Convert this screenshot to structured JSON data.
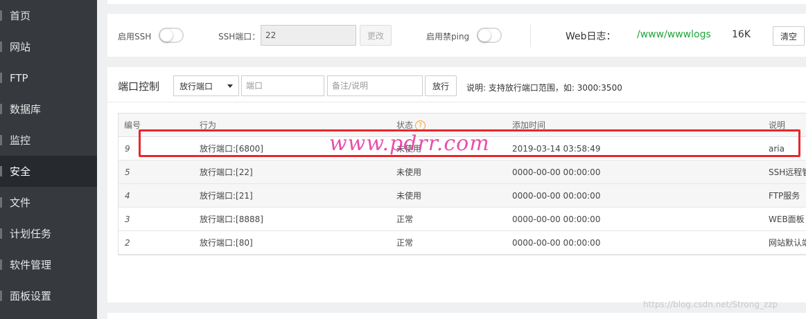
{
  "sidebar": {
    "items": [
      {
        "label": "首页"
      },
      {
        "label": "网站"
      },
      {
        "label": "FTP"
      },
      {
        "label": "数据库"
      },
      {
        "label": "监控"
      },
      {
        "label": "安全"
      },
      {
        "label": "文件"
      },
      {
        "label": "计划任务"
      },
      {
        "label": "软件管理"
      },
      {
        "label": "面板设置"
      }
    ],
    "active": "安全"
  },
  "settings": {
    "ssh_toggle_label": "启用SSH",
    "ssh_port_label": "SSH端口：",
    "ssh_port_value": "22",
    "change_button": "更改",
    "ping_toggle_label": "启用禁ping",
    "web_log_label": "Web日志：",
    "web_log_path": "/www/wwwlogs",
    "web_log_size": "16K",
    "clear_button": "清空"
  },
  "port_control": {
    "title": "端口控制",
    "action_select": "放行端口",
    "port_placeholder": "端口",
    "note_placeholder": "备注/说明",
    "submit_button": "放行",
    "hint": "说明: 支持放行端口范围，如: 3000:3500"
  },
  "table": {
    "headers": [
      "编号",
      "行为",
      "状态",
      "添加时间",
      "说明"
    ],
    "rows": [
      {
        "id": "9",
        "action": "放行端口:[6800]",
        "status": "未使用",
        "time": "2019-03-14 03:58:49",
        "note": "aria"
      },
      {
        "id": "5",
        "action": "放行端口:[22]",
        "status": "未使用",
        "time": "0000-00-00 00:00:00",
        "note": "SSH远程管"
      },
      {
        "id": "4",
        "action": "放行端口:[21]",
        "status": "未使用",
        "time": "0000-00-00 00:00:00",
        "note": "FTP服务"
      },
      {
        "id": "3",
        "action": "放行端口:[8888]",
        "status": "正常",
        "time": "0000-00-00 00:00:00",
        "note": "WEB面板"
      },
      {
        "id": "2",
        "action": "放行端口:[80]",
        "status": "正常",
        "time": "0000-00-00 00:00:00",
        "note": "网站默认端"
      }
    ]
  },
  "watermarks": {
    "site": "www.pdrr.com",
    "blog": "https://blog.csdn.net/Strong_zzp"
  },
  "colors": {
    "sidebar_bg": "#36393e",
    "sidebar_active": "#26292d",
    "log_path": "#20a53a",
    "annotation_red": "#e8262c",
    "watermark_pink": "#e83aa6",
    "help_orange": "#f0a030"
  }
}
